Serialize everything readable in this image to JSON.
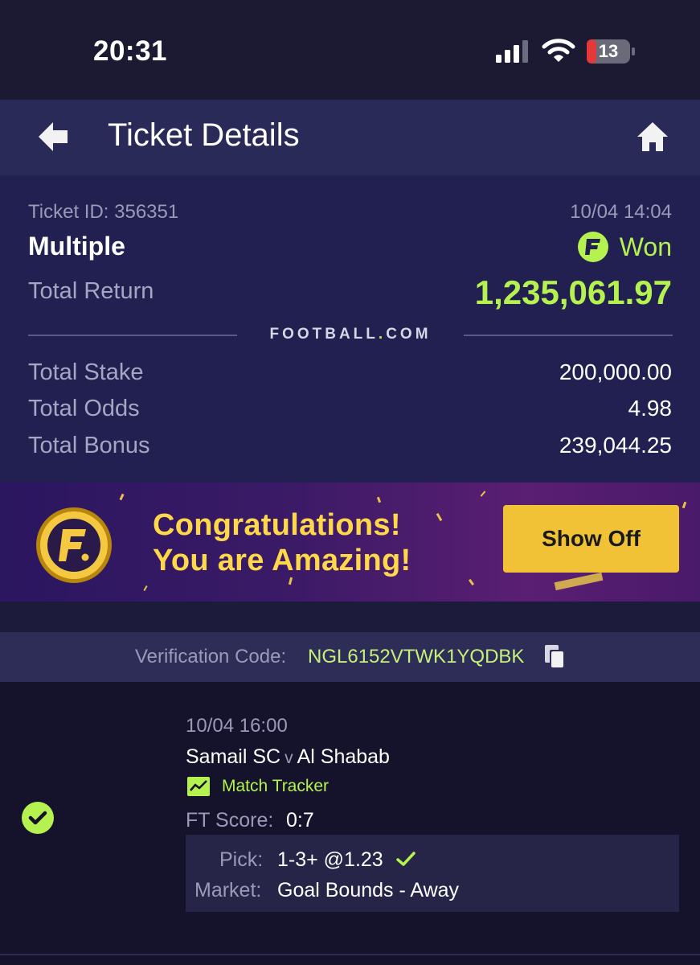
{
  "status_bar": {
    "time": "20:31",
    "battery_level": "13",
    "icons": [
      "signal-icon",
      "wifi-icon",
      "battery-icon"
    ]
  },
  "header": {
    "title": "Ticket Details",
    "icons": [
      "back-arrow-icon",
      "home-icon"
    ]
  },
  "ticket": {
    "id_label": "Ticket ID: 356351",
    "date": "10/04 14:04",
    "bet_type": "Multiple",
    "status": "Won",
    "total_return_label": "Total Return",
    "total_return_value": "1,235,061.97",
    "brand_left": "FOOTBALL",
    "brand_dot": ".",
    "brand_right": "COM",
    "rows": [
      {
        "label": "Total Stake",
        "value": "200,000.00"
      },
      {
        "label": "Total Odds",
        "value": "4.98"
      },
      {
        "label": "Total Bonus",
        "value": "239,044.25"
      }
    ]
  },
  "banner": {
    "line1": "Congratulations!",
    "line2": "You are Amazing!",
    "button_label": "Show Off"
  },
  "verification": {
    "label": "Verification Code:",
    "code": "NGL6152VTWK1YQDBK"
  },
  "match": {
    "date": "10/04 16:00",
    "home": "Samail SC",
    "vs": "v",
    "away": "Al Shabab",
    "tracker_label": "Match Tracker",
    "ft_label": "FT Score:",
    "ft_value": "0:7",
    "pick_label": "Pick:",
    "pick_value": "1-3+ @1.23",
    "market_label": "Market:",
    "market_value": "Goal Bounds - Away"
  },
  "colors": {
    "accent_green": "#b5f24f",
    "header_bg": "#2a2a58",
    "summary_bg": "#222051",
    "button_yellow": "#f2c236",
    "banner_text": "#ffd84a"
  }
}
